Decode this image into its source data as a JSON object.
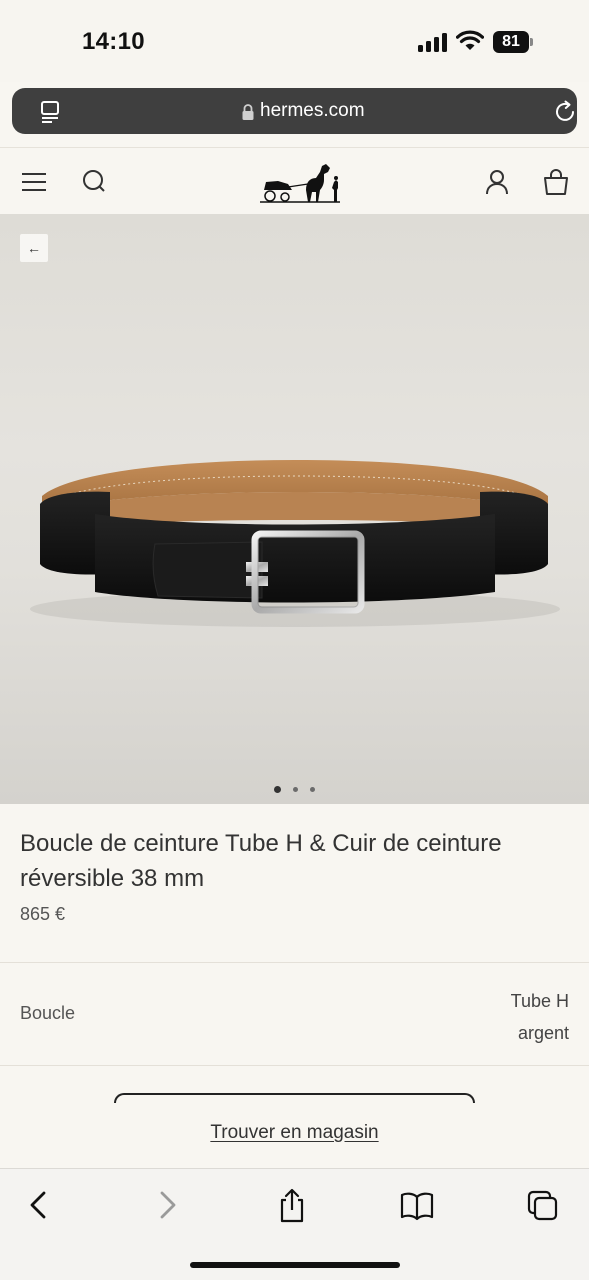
{
  "status_bar": {
    "time": "14:10",
    "battery": "81"
  },
  "browser": {
    "url": "hermes.com",
    "icons": [
      "reader-icon",
      "lock-icon",
      "reload-icon"
    ]
  },
  "site_header": {
    "icons": [
      "menu-icon",
      "search-icon",
      "hermes-logo",
      "account-icon",
      "bag-icon"
    ]
  },
  "hero": {
    "back_label": "←",
    "image_description_icon": "belt-image",
    "slides_total": 3,
    "slide_active": 1
  },
  "product": {
    "title": "Boucle de ceinture Tube H & Cuir de ceinture réversible 38 mm",
    "price": "865 €"
  },
  "options": [
    {
      "label": "Boucle",
      "value": "Tube H argent"
    }
  ],
  "store_link": "Trouver en magasin",
  "toolbar": {
    "icons": [
      "back-icon",
      "forward-icon",
      "share-icon",
      "bookmarks-icon",
      "tabs-icon"
    ]
  },
  "colors": {
    "page_bg": "#f8f6f1",
    "urlbar_bg": "#3f3f3f",
    "text": "#333333",
    "belt_black": "#151515",
    "belt_tan": "#b07a48"
  }
}
